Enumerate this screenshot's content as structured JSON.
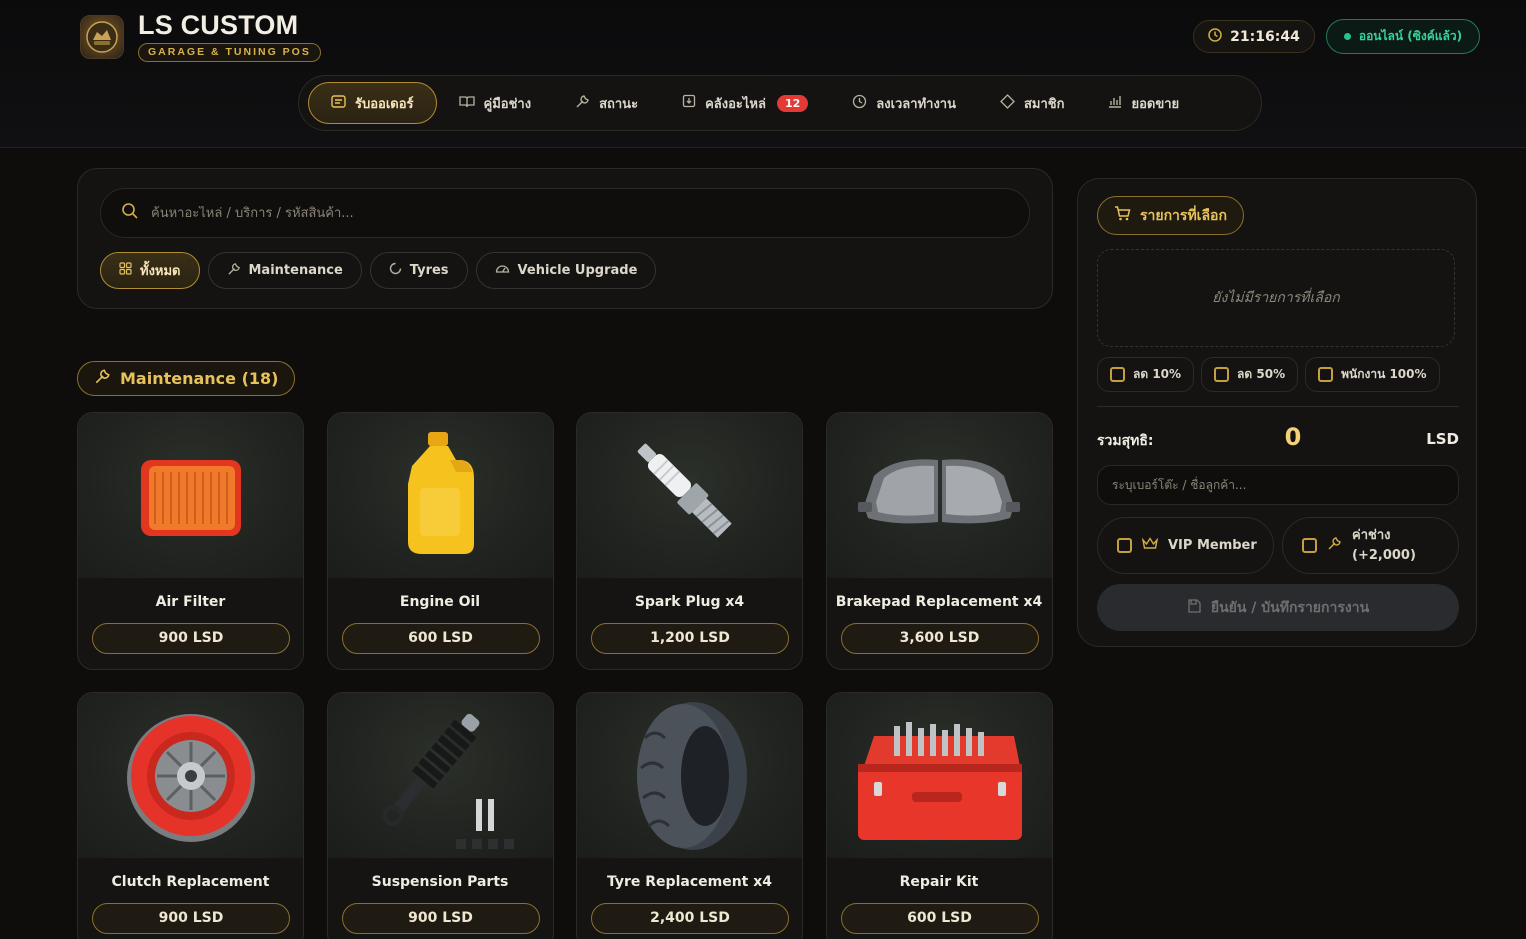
{
  "header": {
    "brand_title": "LS CUSTOM",
    "brand_subtitle": "GARAGE & TUNING POS",
    "clock": "21:16:44",
    "status": "ออนไลน์ (ซิงค์แล้ว)"
  },
  "nav": {
    "items": [
      {
        "label": "รับออเดอร์",
        "icon": "receipt-icon",
        "active": true
      },
      {
        "label": "คู่มือช่าง",
        "icon": "book-icon"
      },
      {
        "label": "สถานะ",
        "icon": "wrench-icon"
      },
      {
        "label": "คลังอะไหล่",
        "icon": "box-icon",
        "badge": "12"
      },
      {
        "label": "ลงเวลาทำงาน",
        "icon": "clock-icon"
      },
      {
        "label": "สมาชิก",
        "icon": "diamond-icon"
      },
      {
        "label": "ยอดขาย",
        "icon": "chart-icon"
      }
    ]
  },
  "search": {
    "placeholder": "ค้นหาอะไหล่ / บริการ / รหัสสินค้า..."
  },
  "filters": [
    {
      "label": "ทั้งหมด",
      "icon": "grid-icon",
      "active": true
    },
    {
      "label": "Maintenance",
      "icon": "wrench-icon"
    },
    {
      "label": "Tyres",
      "icon": "circle-icon"
    },
    {
      "label": "Vehicle Upgrade",
      "icon": "gauge-icon"
    }
  ],
  "section": {
    "title": "Maintenance (18)"
  },
  "products": [
    {
      "name": "Air Filter",
      "price": "900 LSD",
      "image": "air-filter"
    },
    {
      "name": "Engine Oil",
      "price": "600 LSD",
      "image": "engine-oil"
    },
    {
      "name": "Spark Plug x4",
      "price": "1,200 LSD",
      "image": "spark-plug"
    },
    {
      "name": "Brakepad Replacement x4",
      "price": "3,600 LSD",
      "image": "brake-pads"
    },
    {
      "name": "Clutch Replacement",
      "price": "900 LSD",
      "image": "clutch"
    },
    {
      "name": "Suspension Parts",
      "price": "900 LSD",
      "image": "suspension"
    },
    {
      "name": "Tyre Replacement x4",
      "price": "2,400 LSD",
      "image": "tyre"
    },
    {
      "name": "Repair Kit",
      "price": "600 LSD",
      "image": "toolbox"
    }
  ],
  "cart": {
    "title": "รายการที่เลือก",
    "empty_text": "ยังไม่มีรายการที่เลือก",
    "discounts": [
      "ลด 10%",
      "ลด 50%",
      "พนักงาน 100%"
    ],
    "total_label": "รวมสุทธิ:",
    "total_value": "0",
    "total_unit": "LSD",
    "customer_placeholder": "ระบุเบอร์โต๊ะ / ชื่อลูกค้า...",
    "vip_label": "VIP Member",
    "tech_label": "ค่าช่าง",
    "tech_amount": "(+2,000)",
    "confirm_label": "ยืนยัน / บันทึกรายการงาน"
  },
  "colors": {
    "accent": "#d4ad44",
    "online": "#34d399",
    "badge": "#e53935"
  }
}
